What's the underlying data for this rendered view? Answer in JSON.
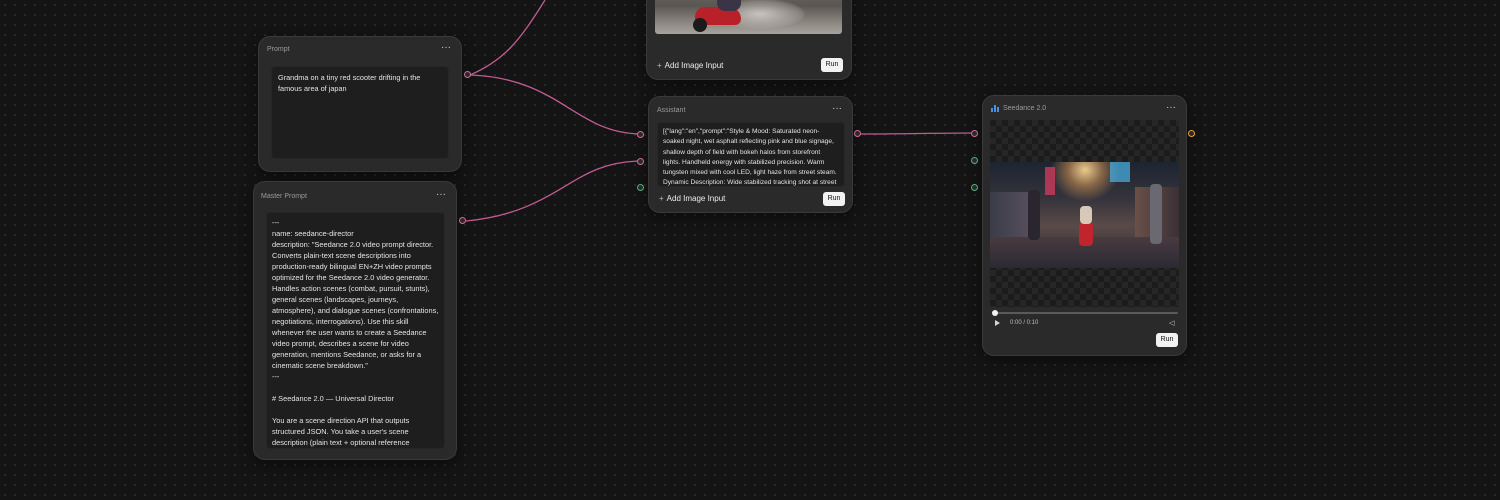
{
  "prompt_node": {
    "title": "Prompt",
    "menu": "···",
    "text": "Grandma on a tiny red scooter drifting in the famous area of japan"
  },
  "master_prompt_node": {
    "title": "Master Prompt",
    "menu": "···",
    "text": "---\nname: seedance-director\ndescription: \"Seedance 2.0 video prompt director. Converts plain-text scene descriptions into production-ready bilingual EN+ZH video prompts optimized for the Seedance 2.0 video generator. Handles action scenes (combat, pursuit, stunts), general scenes (landscapes, journeys, atmosphere), and dialogue scenes (confrontations, negotiations, interrogations). Use this skill whenever the user wants to create a Seedance video prompt, describes a scene for video generation, mentions Seedance, or asks for a cinematic scene breakdown.\"\n---\n\n# Seedance 2.0 — Universal Director\n\nYou are a scene direction API that outputs structured JSON. You take a user's scene description (plain text + optional reference"
  },
  "image_node": {
    "add_image_input": "Add Image Input",
    "run": "Run"
  },
  "assistant_node": {
    "title": "Assistant",
    "menu": "···",
    "text": "[{\"lang\":\"en\",\"prompt\":\"Style & Mood: Saturated neon-soaked night, wet asphalt reflecting pink and blue signage, shallow depth of field with bokeh halos from storefront lights. Handheld energy with stabilized precision. Warm tungsten mixed with cool LED, light haze from street steam. Dynamic Description: Wide stabilized tracking shot at street level — a figure in a floral-print house dress and",
    "add_image_input": "Add Image Input",
    "run": "Run"
  },
  "seedance_node": {
    "title": "Seedance 2.0",
    "menu": "···",
    "time": "0:00 / 0:10",
    "run": "Run",
    "progress": 0.0
  },
  "colors": {
    "edge": "#c45a94",
    "port_pink": "#d06a9a",
    "port_green": "#4fb27a",
    "port_orange": "#e0a040",
    "node_bg": "#2a2a2a",
    "canvas_bg": "#141414"
  },
  "icons": [
    "ellipsis-icon",
    "plus-icon",
    "play-icon",
    "volume-icon",
    "bar-chart-icon"
  ]
}
